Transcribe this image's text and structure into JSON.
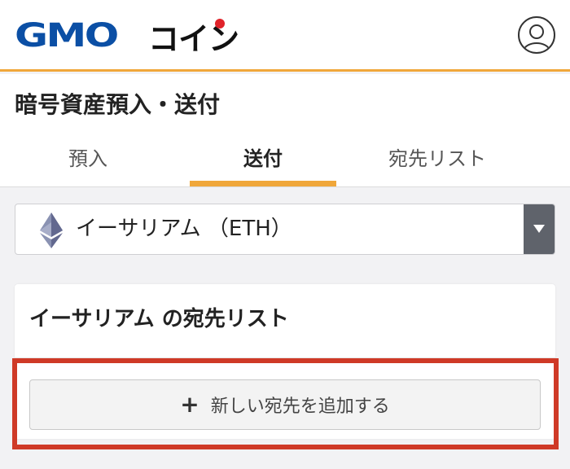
{
  "header": {
    "logo_gmo": "GMO",
    "logo_coin": "コイン",
    "user_icon": "user-icon"
  },
  "page": {
    "title": "暗号資産預入・送付"
  },
  "tabs": [
    {
      "label": "預入",
      "active": false
    },
    {
      "label": "送付",
      "active": true
    },
    {
      "label": "宛先リスト",
      "active": false
    }
  ],
  "currency_select": {
    "icon": "ethereum-icon",
    "selected": "イーサリアム （ETH）",
    "arrow_icon": "caret-down-icon"
  },
  "address_list": {
    "title": "イーサリアム の宛先リスト",
    "add_button_label": "新しい宛先を追加する",
    "add_button_icon": "plus-icon"
  },
  "colors": {
    "accent": "#f0a73a",
    "brand_blue": "#0b4fa5",
    "brand_red": "#e0232a",
    "highlight": "#cf3a27"
  }
}
